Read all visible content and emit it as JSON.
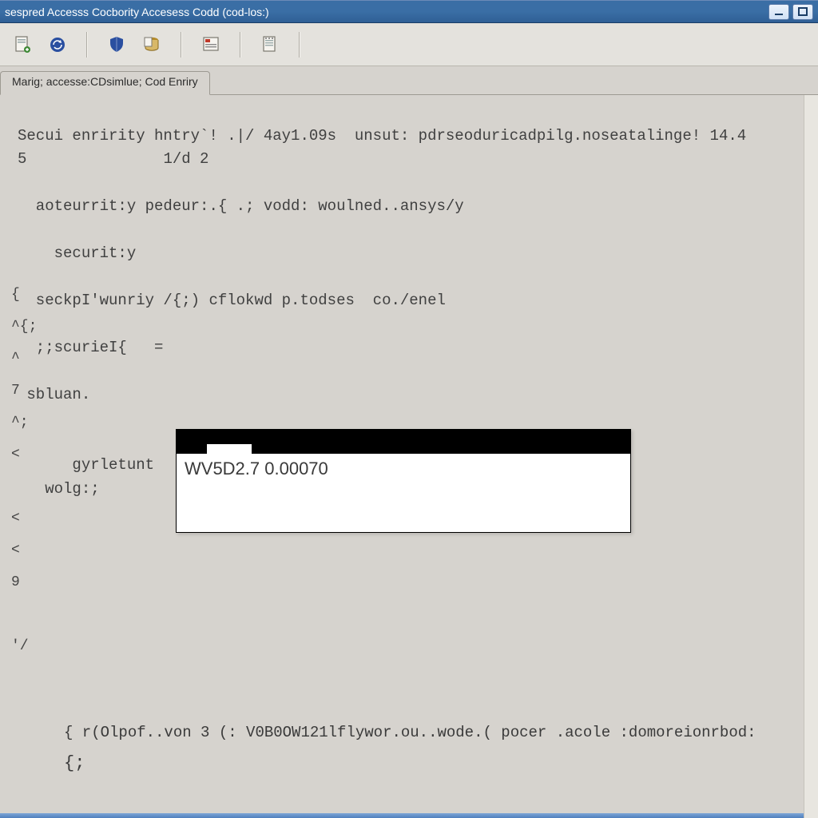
{
  "window": {
    "title": "sespred Accesss Cocbority Accesess Codd (cod-los:)",
    "minimize_tooltip": "Minimize",
    "maximize_tooltip": "Maximize"
  },
  "toolbar": {
    "icons": {
      "new_doc": "new-document-icon",
      "refresh": "refresh-icon",
      "shield": "shield-icon",
      "db": "database-icon",
      "form": "form-icon",
      "note": "note-icon"
    }
  },
  "tabs": {
    "active_label": "Marig; accesse:CDsimlue; Cod Enriry"
  },
  "editor": {
    "line1": "Secui enririty hntry`! .|/ 4ay1.09s  unsut: pdrseoduricadpilg.noseatalinge! 14.4",
    "line2_left": "5",
    "line2_right": "1/d 2",
    "line3": "  aoteurrit:y pedeur:.{ .; vodd: woulned..ansys/y",
    "line4": "    securit:y",
    "line5": "  seckpI'wunriy /{;) cflokwd p.todses  co./enel",
    "line6": "  ;;scurieI{   =",
    "line7": " sbluan.",
    "line8": "      gyrletunt",
    "line9": "   wolg:;",
    "footer_line": "{  r(Olpof..von  3 (:  V0B0OW121lflywor.ou..wode.(  pocer .acole  :domoreionrbod:",
    "footer_brace": "{;",
    "gutter": [
      "{",
      "^{;",
      "^",
      "7",
      "^;",
      "<",
      "",
      "<",
      "<",
      "9",
      "",
      "'/"
    ]
  },
  "popup": {
    "value": "WV5D2.7 0.00070"
  }
}
